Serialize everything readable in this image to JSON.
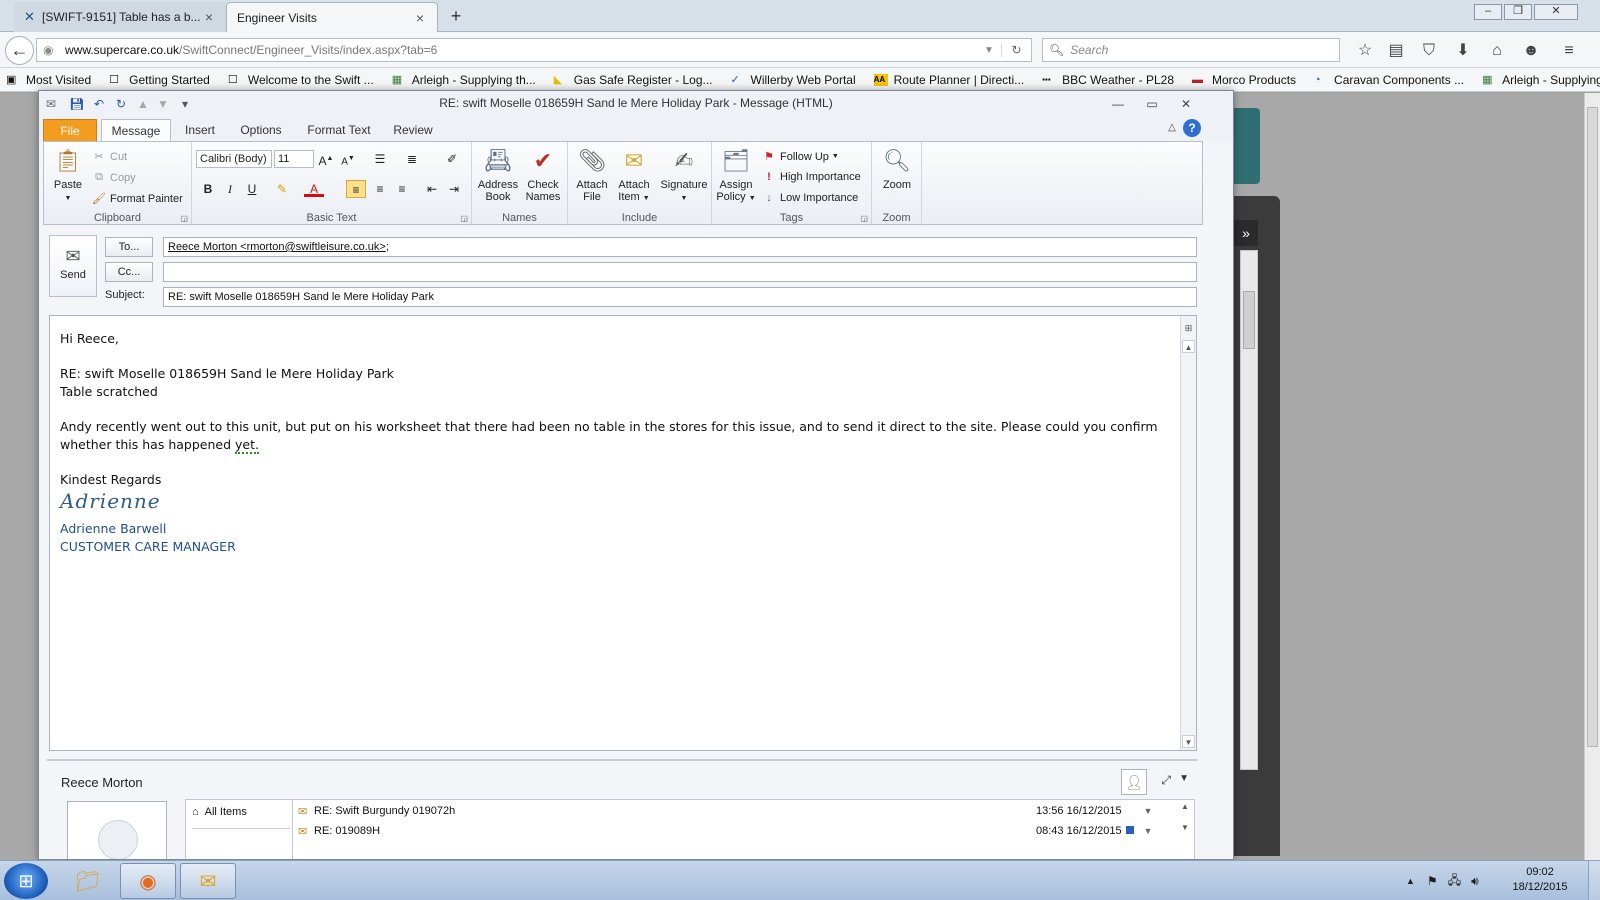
{
  "browser": {
    "tabs": [
      {
        "label": "[SWIFT-9151] Table has a b...",
        "active": false
      },
      {
        "label": "Engineer Visits",
        "active": true
      }
    ],
    "url_domain": "www.supercare.co.uk",
    "url_path": "/SwiftConnect/Engineer_Visits/index.aspx?tab=6",
    "search_placeholder": "Search",
    "bookmarks": [
      "Most Visited",
      "Getting Started",
      "Welcome to the Swift ...",
      "Arleigh - Supplying th...",
      "Gas Safe Register - Log...",
      "Willerby Web Portal",
      "Route Planner | Directi...",
      "BBC Weather - PL28",
      "Morco Products",
      "Caravan Components ...",
      "Arleigh - Supplying th..."
    ]
  },
  "outlook": {
    "window_title": "RE: swift Moselle  018659H Sand le Mere Holiday Park  -  Message (HTML)",
    "ribbon_tabs": [
      "File",
      "Message",
      "Insert",
      "Options",
      "Format Text",
      "Review"
    ],
    "ribbon": {
      "clipboard": {
        "paste": "Paste",
        "cut": "Cut",
        "copy": "Copy",
        "format_painter": "Format Painter",
        "label": "Clipboard"
      },
      "basic_text": {
        "font": "Calibri (Body)",
        "size": "11",
        "bold": "B",
        "italic": "I",
        "underline": "U",
        "label": "Basic Text"
      },
      "names": {
        "address_book": "Address Book",
        "check_names": "Check Names",
        "label": "Names"
      },
      "include": {
        "attach_file": "Attach File",
        "attach_item": "Attach Item",
        "signature": "Signature",
        "label": "Include"
      },
      "tags": {
        "assign_policy": "Assign Policy",
        "follow_up": "Follow Up",
        "high_importance": "High Importance",
        "low_importance": "Low Importance",
        "label": "Tags"
      },
      "zoom": {
        "zoom": "Zoom",
        "label": "Zoom"
      }
    },
    "compose": {
      "send": "Send",
      "to_button": "To...",
      "cc_button": "Cc...",
      "subject_label": "Subject:",
      "to_value": "Reece Morton <rmorton@swiftleisure.co.uk>",
      "to_suffix": ";",
      "cc_value": "",
      "subject_value": "RE: swift Moselle  018659H Sand le Mere Holiday Park"
    },
    "body": {
      "greeting": "Hi Reece,",
      "ref_line": "RE: swift Moselle 018659H Sand le Mere Holiday Park",
      "issue_line": "Table scratched",
      "para_main": "Andy recently went out to this unit, but put on his worksheet that there had been no table in the stores for this issue, and to send it direct to the site.  Please could you confirm whether this has happened ",
      "para_spell": "yet.",
      "closing": "Kindest Regards",
      "signature_script": "Adrienne",
      "sig_name": "Adrienne Barwell",
      "sig_title": "CUSTOMER CARE MANAGER"
    },
    "people_pane": {
      "name": "Reece Morton",
      "all_items": "All Items",
      "messages": [
        {
          "subject": "RE: Swift Burgundy 019072h",
          "time": "13:56  16/12/2015"
        },
        {
          "subject": "RE: 019089H",
          "time": "08:43  16/12/2015"
        }
      ]
    }
  },
  "taskbar": {
    "time": "09:02",
    "date": "18/12/2015"
  },
  "colors": {
    "file_tab": "#f39c1f",
    "signature_blue": "#1f4e8c",
    "page_teal": "#2f6f71"
  }
}
